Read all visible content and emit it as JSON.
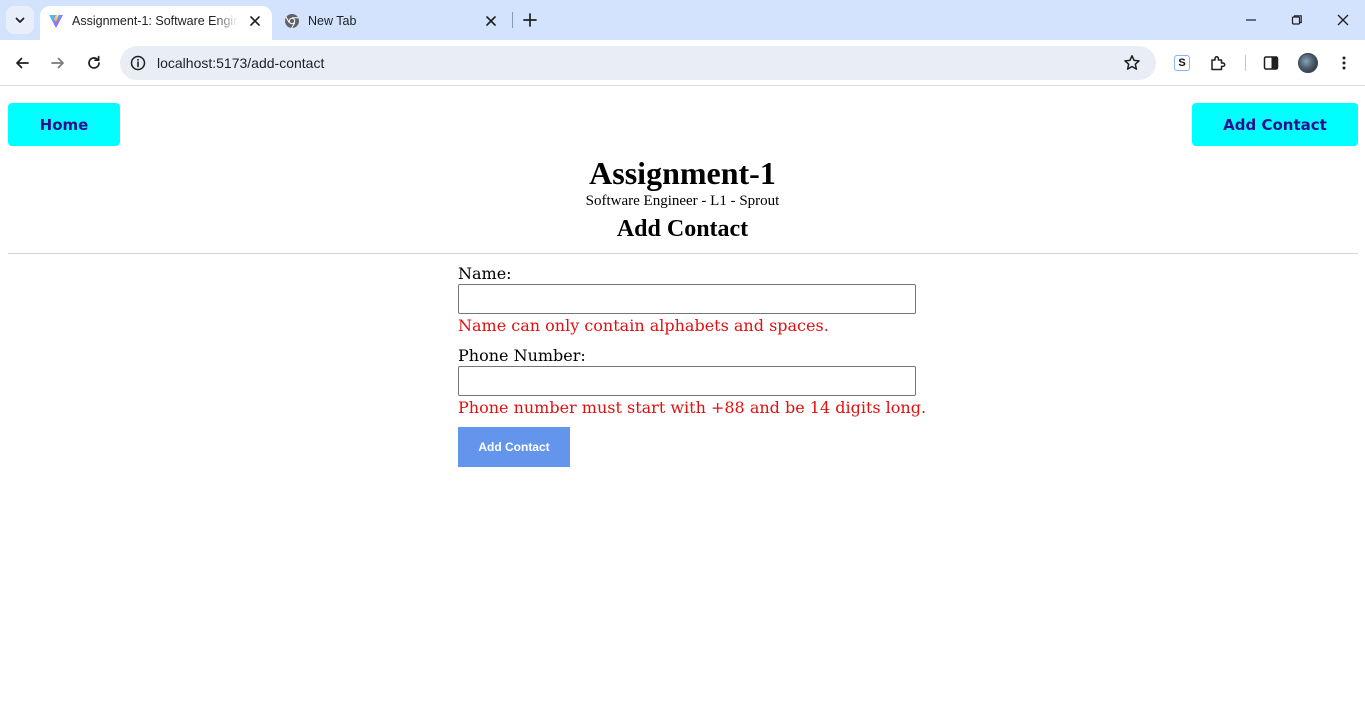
{
  "browser": {
    "tabs": [
      {
        "title": "Assignment-1: Software Engineer - L1 - Sprout",
        "active": true,
        "favicon": "vite-logo-icon"
      },
      {
        "title": "New Tab",
        "active": false,
        "favicon": "chrome-logo-icon"
      }
    ],
    "url": "localhost:5173/add-contact",
    "extension_label": "S"
  },
  "nav": {
    "home_label": "Home",
    "add_contact_label": "Add Contact",
    "button_color": "#00ffff",
    "button_text_color": "#2b0f8f"
  },
  "header": {
    "title": "Assignment-1",
    "subtitle": "Software Engineer - L1 - Sprout",
    "page_heading": "Add Contact"
  },
  "form": {
    "name_label": "Name:",
    "name_value": "",
    "name_error": "Name can only contain alphabets and spaces.",
    "phone_label": "Phone Number:",
    "phone_value": "",
    "phone_error": "Phone number must start with +88 and be 14 digits long.",
    "submit_label": "Add Contact",
    "submit_color": "#6495ed",
    "error_color": "#e01010"
  }
}
